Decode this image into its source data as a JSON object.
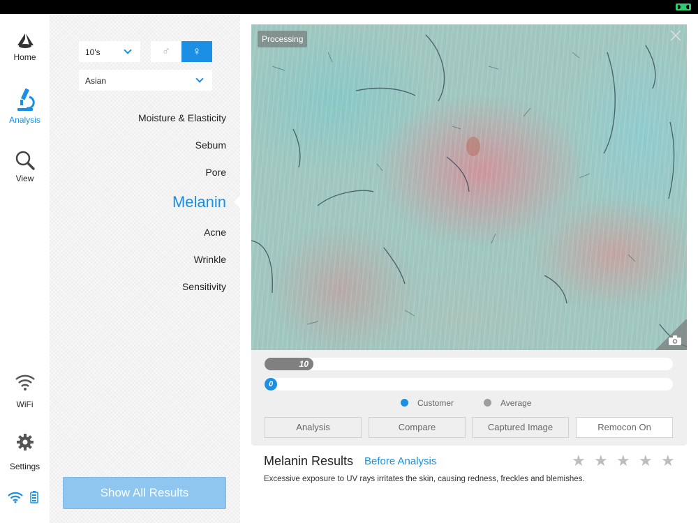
{
  "nav": {
    "home": "Home",
    "analysis": "Analysis",
    "view": "View",
    "wifi": "WiFi",
    "settings": "Settings",
    "active": "analysis"
  },
  "filters": {
    "age": "10's",
    "ethnicity": "Asian",
    "gender_male_symbol": "♂",
    "gender_female_symbol": "♀",
    "selected_gender": "female"
  },
  "menu": {
    "items": [
      "Moisture & Elasticity",
      "Sebum",
      "Pore",
      "Melanin",
      "Acne",
      "Wrinkle",
      "Sensitivity"
    ],
    "active": "Melanin"
  },
  "show_all_label": "Show All Results",
  "camera": {
    "status": "Processing"
  },
  "scores": {
    "average_value": "10",
    "customer_value": "0",
    "average_fraction": 0.12,
    "customer_fraction": 0.0
  },
  "legend": {
    "customer": "Customer",
    "average": "Average",
    "customer_color": "#1a8fe3",
    "average_color": "#9e9e9e"
  },
  "buttons": {
    "analysis": "Analysis",
    "compare": "Compare",
    "captured_image": "Captured Image",
    "remocon": "Remocon On"
  },
  "result": {
    "title": "Melanin Results",
    "before": "Before Analysis",
    "description": "Excessive exposure to UV rays irritates the skin, causing redness, freckles and blemishes.",
    "rating": 0,
    "max_rating": 5
  },
  "colors": {
    "accent": "#1a8fe3",
    "show_all_bg": "#8ec6f0"
  }
}
